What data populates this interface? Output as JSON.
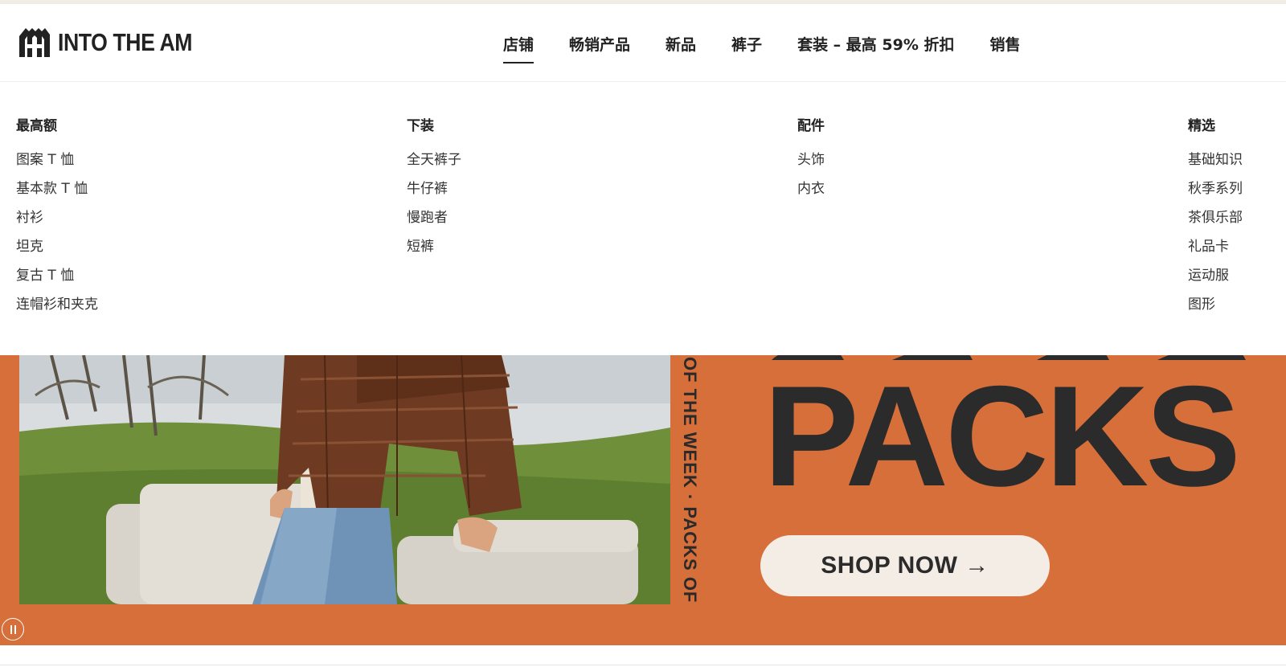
{
  "brand": {
    "name": "INTO THE AM"
  },
  "nav": {
    "items": [
      {
        "label": "店铺",
        "active": true
      },
      {
        "label": "畅销产品"
      },
      {
        "label": "新品"
      },
      {
        "label": "裤子"
      },
      {
        "label": "套装 – 最高 59% 折扣"
      },
      {
        "label": "销售"
      }
    ]
  },
  "mega_menu": {
    "columns": [
      {
        "title": "最高额",
        "links": [
          "图案 T 恤",
          "基本款 T 恤",
          "衬衫",
          "坦克",
          "复古 T 恤",
          "连帽衫和夹克"
        ]
      },
      {
        "title": "下装",
        "links": [
          "全天裤子",
          "牛仔裤",
          "慢跑者",
          "短裤"
        ]
      },
      {
        "title": "配件",
        "links": [
          "头饰",
          "内衣"
        ]
      },
      {
        "title": "精选",
        "links": [
          "基础知识",
          "秋季系列",
          "茶俱乐部",
          "礼品卡",
          "运动服",
          "图形"
        ]
      }
    ]
  },
  "banner": {
    "vertical_text": "OF THE WEEK · PACKS OF",
    "headline": "PACKS",
    "cta_label": "SHOP NOW →",
    "pause_icon": "pause-icon",
    "background_color": "#d66f3a",
    "text_color": "#2b2b2b",
    "cta_background": "#f4ede6"
  }
}
